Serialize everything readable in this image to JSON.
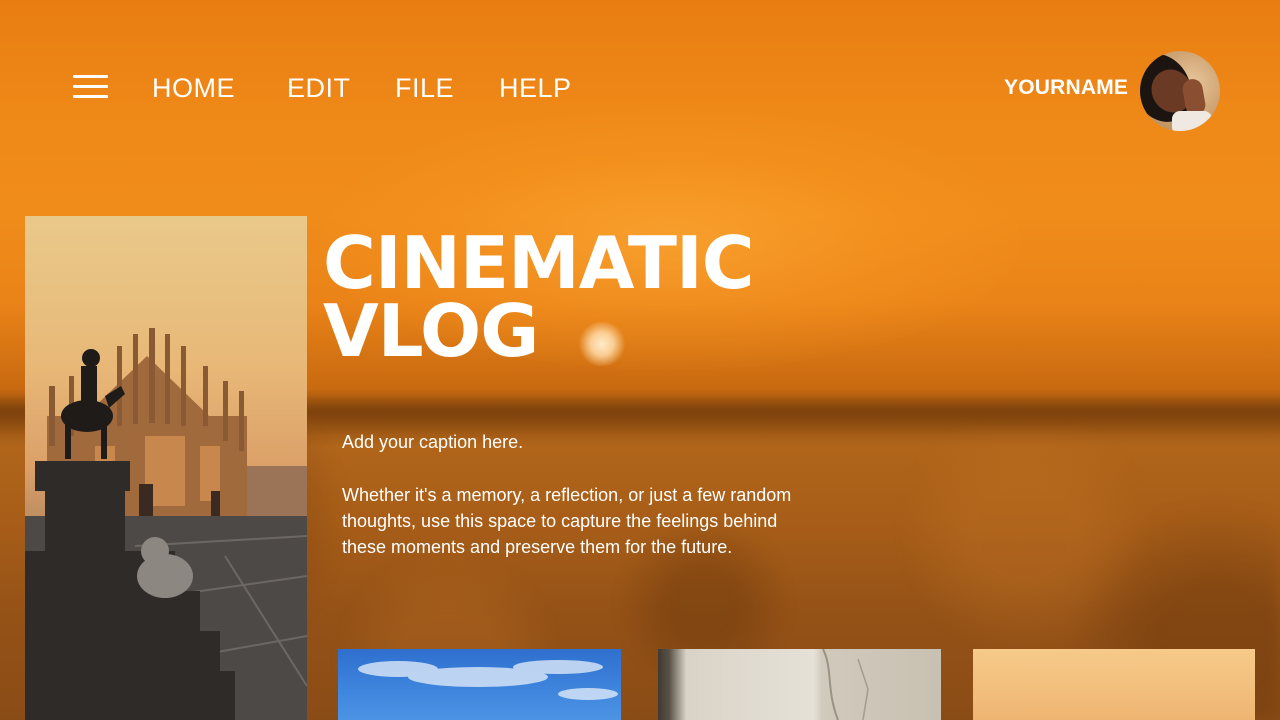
{
  "nav": {
    "menu_icon": "hamburger-menu-icon",
    "items": [
      {
        "label": "HOME"
      },
      {
        "label": "EDIT"
      },
      {
        "label": "FILE"
      },
      {
        "label": "HELP"
      }
    ]
  },
  "user": {
    "name": "YOURNAME"
  },
  "hero": {
    "title_line1": "CINEMATIC",
    "title_line2": "VLOG",
    "caption": "Add your caption here.",
    "body": "Whether it's a memory, a reflection, or just a few random thoughts, use this space to capture the feelings behind these moments and preserve them for the future."
  },
  "colors": {
    "background_orange": "#ef8a18",
    "text_white": "#ffffff"
  }
}
